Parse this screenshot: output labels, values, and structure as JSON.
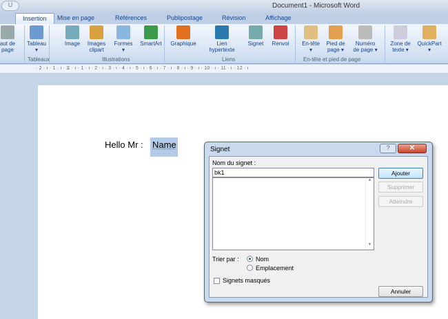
{
  "window": {
    "title": "Document1 - Microsoft Word",
    "quick_access": "U"
  },
  "tabs": [
    "Insertion",
    "Mise en page",
    "Références",
    "Publipostage",
    "Révision",
    "Affichage"
  ],
  "ribbon": {
    "buttons": [
      {
        "label": "aut de\npage",
        "icon": "page-break-icon",
        "color": "#9aa"
      },
      {
        "label": "Tableau\n▾",
        "icon": "table-icon",
        "color": "#6d9bd1"
      },
      {
        "label": "Image",
        "icon": "image-icon",
        "color": "#7ab"
      },
      {
        "label": "Images\nclipart",
        "icon": "clipart-icon",
        "color": "#d9a040"
      },
      {
        "label": "Formes\n▾",
        "icon": "shapes-icon",
        "color": "#8ab6e0"
      },
      {
        "label": "SmartArt",
        "icon": "smartart-icon",
        "color": "#3a9a4a"
      },
      {
        "label": "Graphique",
        "icon": "chart-icon",
        "color": "#e07020"
      },
      {
        "label": "Lien\nhypertexte",
        "icon": "hyperlink-globe-icon",
        "color": "#2a7ab0"
      },
      {
        "label": "Signet",
        "icon": "bookmark-icon",
        "color": "#7aa"
      },
      {
        "label": "Renvoi",
        "icon": "cross-reference-icon",
        "color": "#c44"
      },
      {
        "label": "En-tête\n▾",
        "icon": "header-icon",
        "color": "#e0c080"
      },
      {
        "label": "Pied de\npage ▾",
        "icon": "footer-icon",
        "color": "#e0a050"
      },
      {
        "label": "Numéro\nde page ▾",
        "icon": "page-number-icon",
        "color": "#bbb"
      },
      {
        "label": "Zone de\ntexte ▾",
        "icon": "text-box-icon",
        "color": "#ccd"
      },
      {
        "label": "QuickPart\n▾",
        "icon": "quickpart-icon",
        "color": "#e0b060"
      }
    ],
    "groups": [
      "Tableaux",
      "Illustrations",
      "Liens",
      "En-tête et pied de page"
    ]
  },
  "ruler": "· 2 · ı · 1 · ı · ⧖ · ı · 1 · ı · 2 · ı · 3 · ı · 4 · ı · 5 · ı · 6 · ı · 7 · ı · 8 · ı · 9 · ı · 10 · ı · 11 · ı · 12 · ı",
  "document": {
    "text": "Hello Mr :",
    "selected": "Name"
  },
  "dialog": {
    "title": "Signet",
    "help": "?",
    "close": "✕",
    "name_label": "Nom du signet :",
    "name_value": "bk1",
    "add": "Ajouter",
    "delete": "Supprimer",
    "goto": "Atteindre",
    "sort_label": "Trier par :",
    "sort_options": [
      "Nom",
      "Emplacement"
    ],
    "sort_selected": "Nom",
    "hidden_label": "Signets masqués",
    "hidden_checked": false,
    "cancel": "Annuler"
  }
}
